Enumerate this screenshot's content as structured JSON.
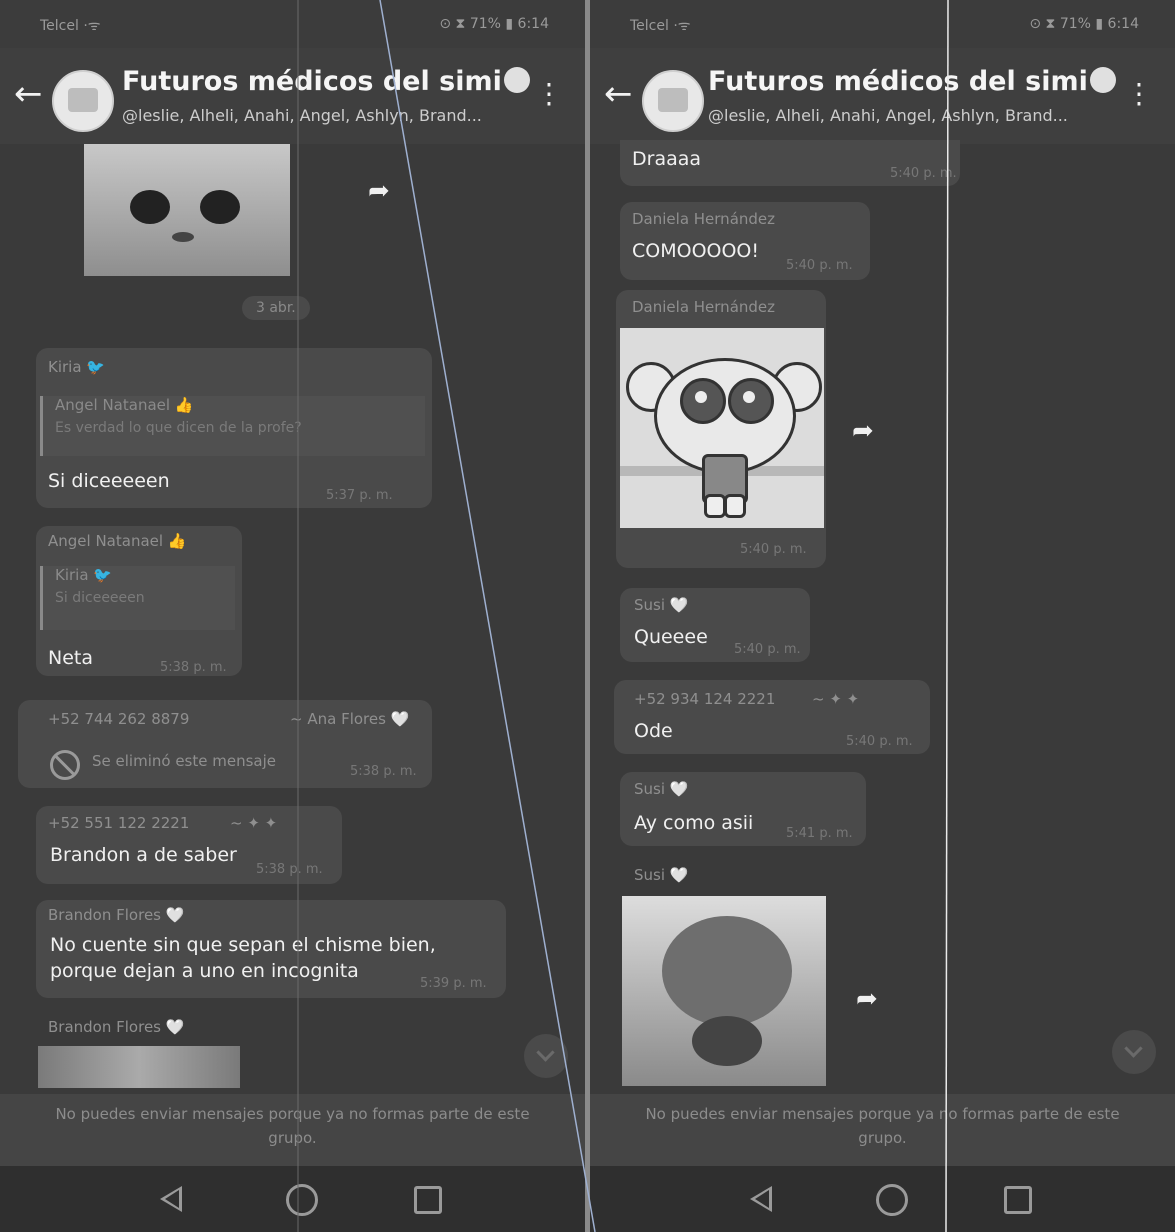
{
  "screens": [
    {
      "status": {
        "left": "Telcel ⋅ᯤ",
        "right": "⊙ ⧗ 71% ▮ 6:14"
      },
      "header": {
        "back_icon": "←",
        "title": "Futuros médicos del simi",
        "subtitle": "@leslie, Alheli, Anahi, Angel, Ashlyn, Brand...",
        "menu_icon": "⋮"
      },
      "date_chip": "3 abr.",
      "messages": [
        {
          "sender": "Kiria 🐦",
          "quote_name": "Angel Natanael 👍",
          "quote_text": "Es verdad lo que dicen de la profe?",
          "text": "Si diceeeeen",
          "time": "5:37 p. m."
        },
        {
          "sender": "Angel Natanael 👍",
          "quote_name": "Kiria 🐦",
          "quote_text": "Si diceeeeen",
          "text": "Neta",
          "time": "5:38 p. m."
        },
        {
          "sender": "+52 744 262 8879",
          "sender_extra": "~ Ana Flores 🤍",
          "text": "Se eliminó este mensaje",
          "time": "5:38 p. m."
        },
        {
          "sender": "+52 551 122 2221",
          "sender_extra": "~ ✦ ✦",
          "text": "Brandon a de saber",
          "time": "5:38 p. m."
        },
        {
          "sender": "Brandon Flores 🤍",
          "text1": "No cuente sin que sepan el chisme bien,",
          "text2": "porque dejan a uno en incognita",
          "time": "5:39 p. m."
        },
        {
          "sender": "Brandon Flores 🤍"
        }
      ],
      "footer": "No puedes enviar mensajes porque ya no formas parte de este grupo."
    },
    {
      "status": {
        "left": "Telcel ⋅ᯤ",
        "right": "⊙ ⧗ 71% ▮ 6:14"
      },
      "header": {
        "back_icon": "←",
        "title": "Futuros médicos del simi",
        "subtitle": "@leslie, Alheli, Anahi, Angel, Ashlyn, Brand...",
        "menu_icon": "⋮"
      },
      "messages": [
        {
          "text": "Draaaa",
          "time": "5:40 p. m."
        },
        {
          "sender": "Daniela Hernández",
          "text": "COMOOOOO!",
          "time": "5:40 p. m."
        },
        {
          "sender": "Daniela Hernández",
          "time": "5:40 p. m."
        },
        {
          "sender": "Susi 🤍",
          "text": "Queeee",
          "time": "5:40 p. m."
        },
        {
          "sender": "+52 934 124 2221",
          "sender_extra": "~ ✦ ✦",
          "text": "Ode",
          "time": "5:40 p. m."
        },
        {
          "sender": "Susi 🤍",
          "text": "Ay como asii",
          "time": "5:41 p. m."
        },
        {
          "sender": "Susi 🤍"
        }
      ],
      "footer": "No puedes enviar mensajes porque ya no formas parte de este grupo."
    }
  ],
  "icons": {
    "share": "share-icon",
    "scroll": "chevron-down-icon",
    "nav_back": "triangle-back-icon",
    "nav_home": "circle-home-icon",
    "nav_recent": "square-recent-icon"
  }
}
